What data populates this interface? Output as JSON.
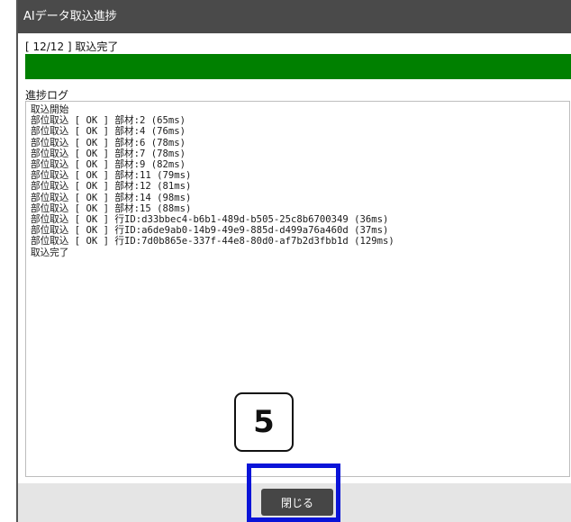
{
  "dialog": {
    "title": "AIデータ取込進捗"
  },
  "progress": {
    "status_text": "[ 12/12 ] 取込完了",
    "fraction": 1.0,
    "fill_color": "#008000"
  },
  "log": {
    "label": "進捗ログ",
    "lines": [
      "取込開始",
      "部位取込 [ OK ] 部材:2 (65ms)",
      "部位取込 [ OK ] 部材:4 (76ms)",
      "部位取込 [ OK ] 部材:6 (78ms)",
      "部位取込 [ OK ] 部材:7 (78ms)",
      "部位取込 [ OK ] 部材:9 (82ms)",
      "部位取込 [ OK ] 部材:11 (79ms)",
      "部位取込 [ OK ] 部材:12 (81ms)",
      "部位取込 [ OK ] 部材:14 (98ms)",
      "部位取込 [ OK ] 部材:15 (88ms)",
      "部位取込 [ OK ] 行ID:d33bbec4-b6b1-489d-b505-25c8b6700349 (36ms)",
      "部位取込 [ OK ] 行ID:a6de9ab0-14b9-49e9-885d-d499a76a460d (37ms)",
      "部位取込 [ OK ] 行ID:7d0b865e-337f-44e8-80d0-af7b2d3fbb1d (129ms)",
      "取込完了"
    ]
  },
  "footer": {
    "close_label": "閉じる"
  },
  "annotation": {
    "callout_number": "5",
    "highlight_color": "#0a14d8"
  }
}
